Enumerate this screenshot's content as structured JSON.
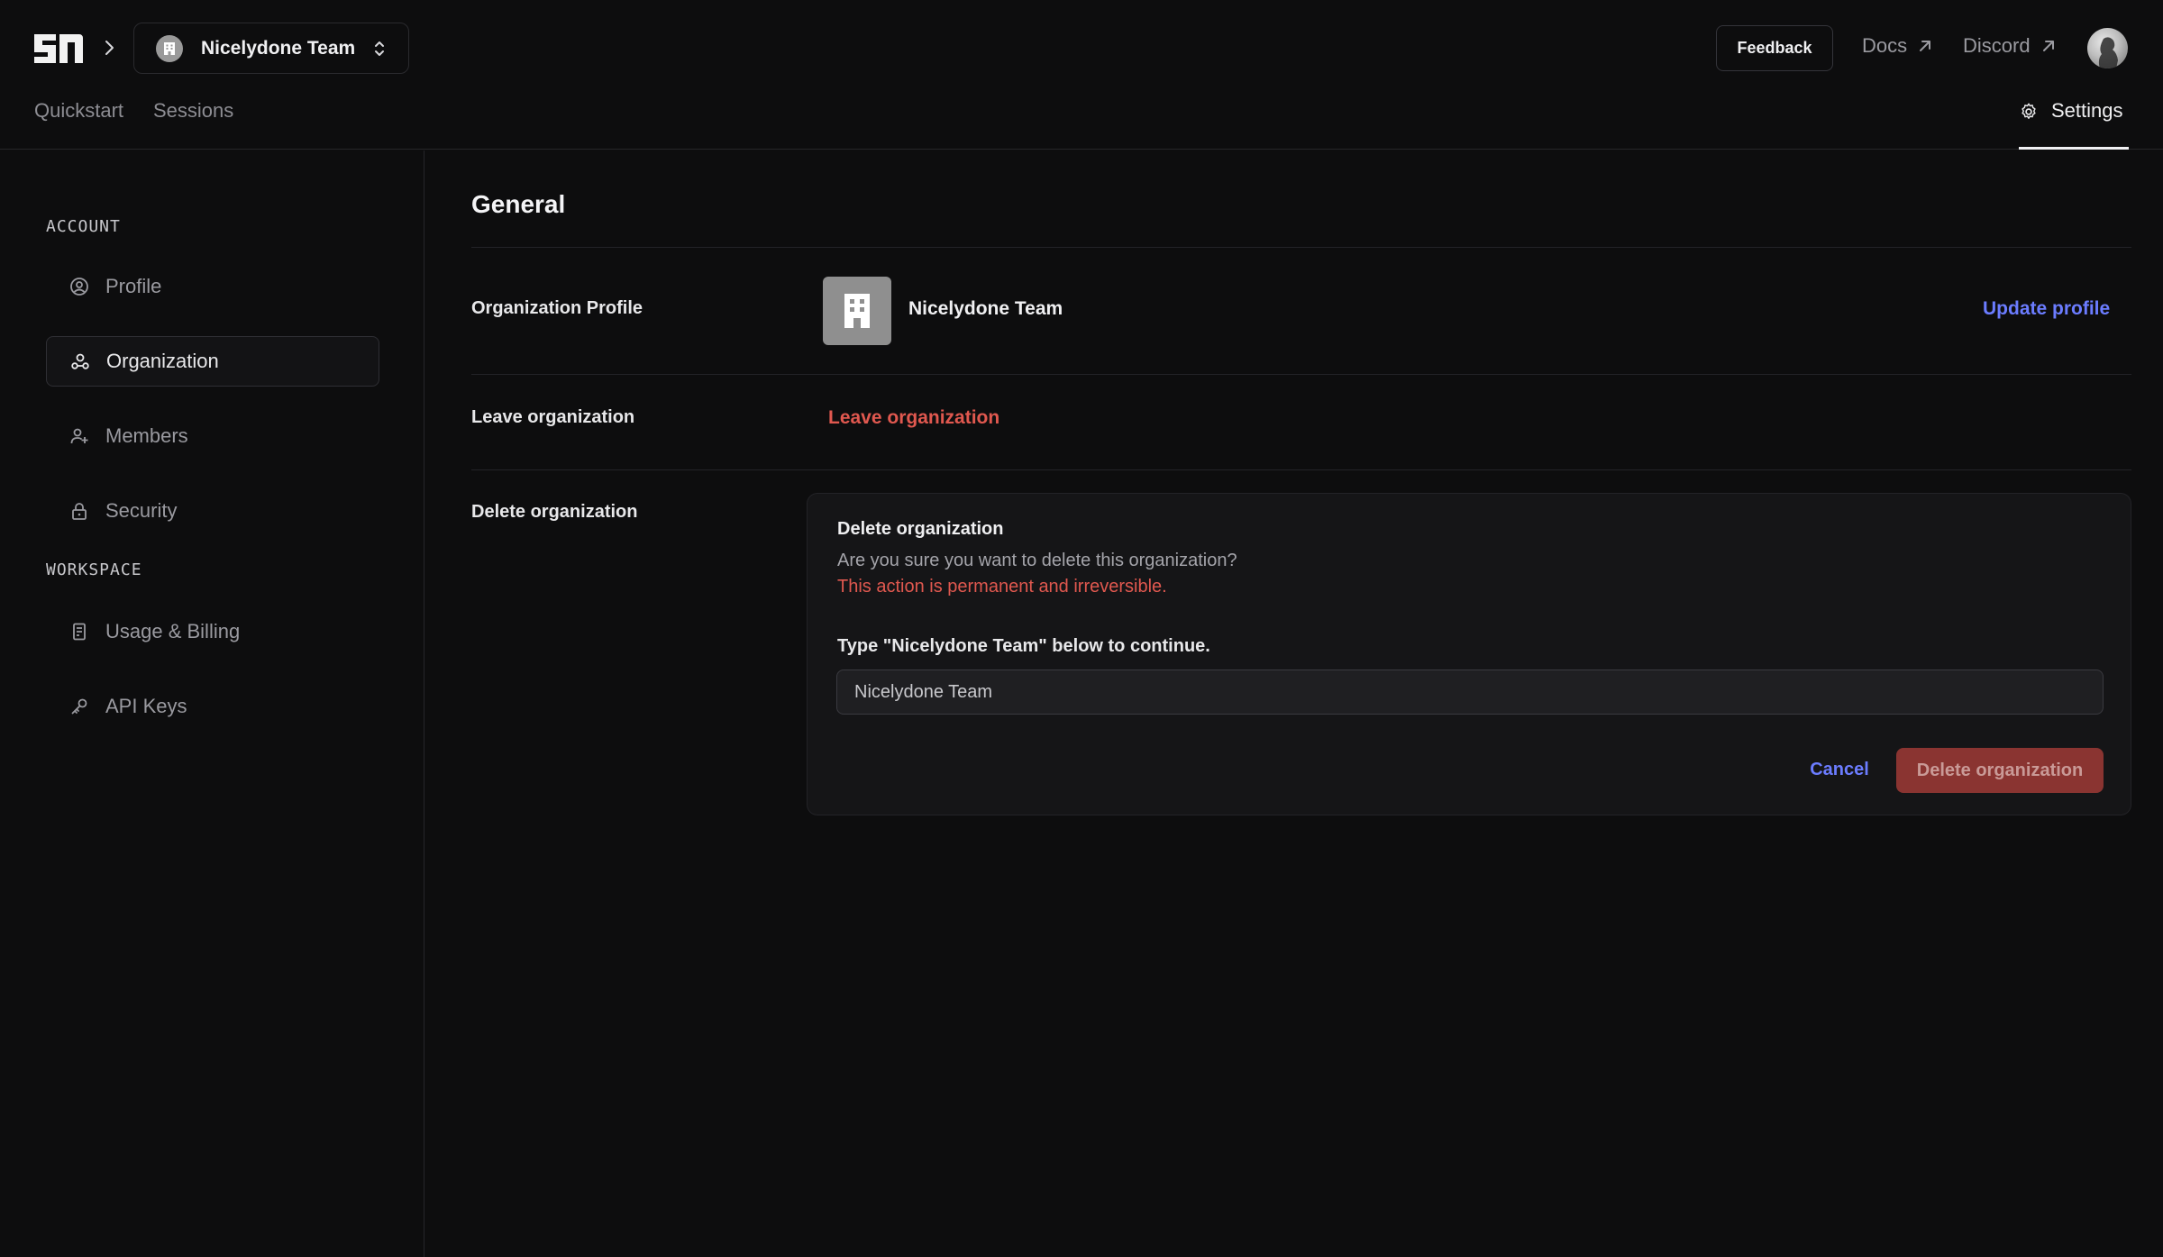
{
  "header": {
    "logo_text": "SI",
    "team": {
      "name": "Nicelydone Team"
    },
    "feedback_label": "Feedback",
    "docs_label": "Docs",
    "discord_label": "Discord",
    "tabs": [
      {
        "label": "Quickstart"
      },
      {
        "label": "Sessions"
      }
    ],
    "settings_label": "Settings"
  },
  "sidebar": {
    "account_heading": "ACCOUNT",
    "workspace_heading": "WORKSPACE",
    "items": [
      {
        "label": "Profile",
        "icon": "user-circle-icon"
      },
      {
        "label": "Organization",
        "icon": "organization-icon",
        "active": true
      },
      {
        "label": "Members",
        "icon": "user-plus-icon"
      },
      {
        "label": "Security",
        "icon": "lock-icon"
      },
      {
        "label": "Usage & Billing",
        "icon": "receipt-icon"
      },
      {
        "label": "API Keys",
        "icon": "key-icon"
      }
    ]
  },
  "main": {
    "title": "General",
    "org_profile": {
      "label": "Organization Profile",
      "name": "Nicelydone Team",
      "update_label": "Update profile"
    },
    "leave": {
      "label": "Leave organization",
      "action_label": "Leave organization"
    },
    "delete": {
      "label": "Delete organization",
      "card_title": "Delete organization",
      "question": "Are you sure you want to delete this organization?",
      "warning": "This action is permanent and irreversible.",
      "prompt": "Type \"Nicelydone Team\" below to continue.",
      "input_value": "Nicelydone Team",
      "cancel_label": "Cancel",
      "confirm_label": "Delete organization"
    }
  },
  "colors": {
    "background": "#0d0d0e",
    "accent_link": "#6b7cff",
    "danger": "#e0584f",
    "danger_button": "#8a3431"
  }
}
